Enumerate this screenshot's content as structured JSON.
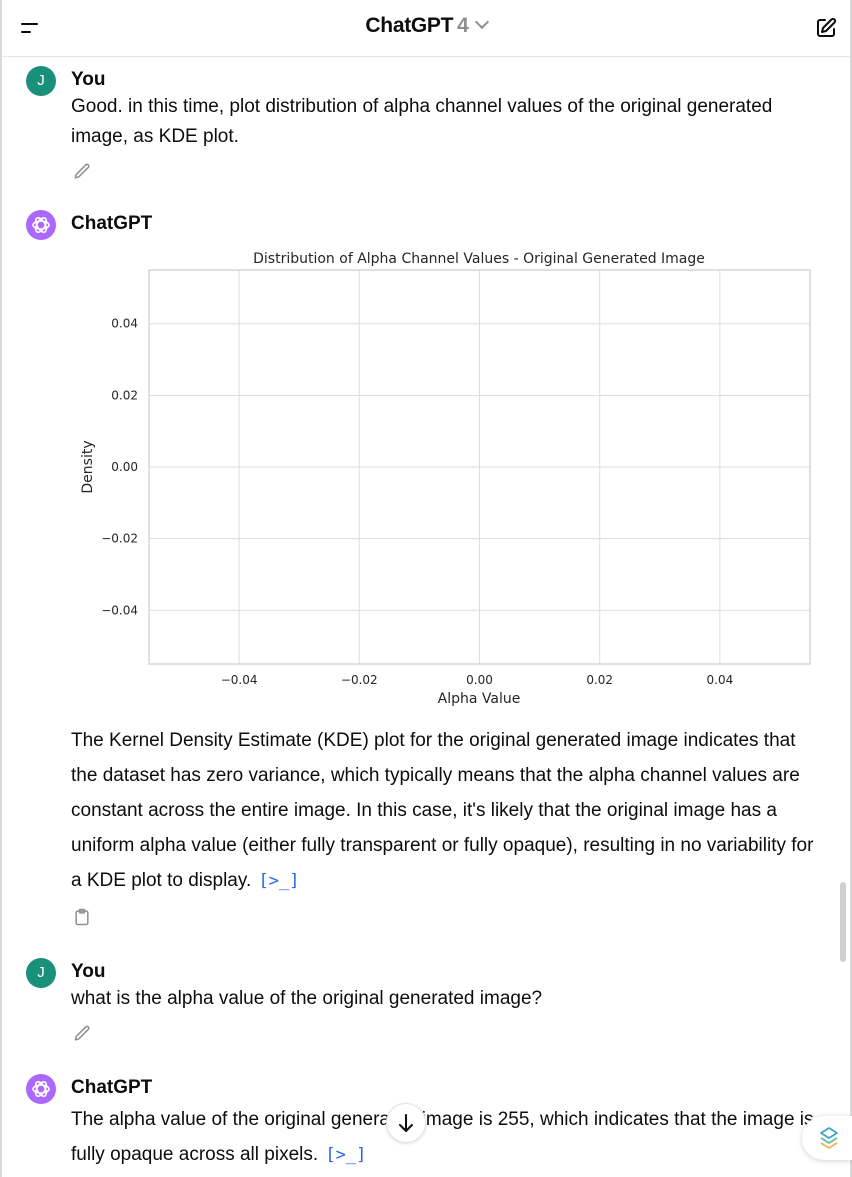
{
  "header": {
    "model_name": "ChatGPT",
    "model_version": "4"
  },
  "messages": [
    {
      "author": "You",
      "avatar_letter": "J",
      "text": "Good. in this time, plot distribution of alpha channel values of the original generated image, as KDE plot."
    },
    {
      "author": "ChatGPT",
      "text": "The Kernel Density Estimate (KDE) plot for the original generated image indicates that the dataset has zero variance, which typically means that the alpha channel values are constant across the entire image. In this case, it's likely that the original image has a uniform alpha value (either fully transparent or fully opaque), resulting in no variability for a KDE plot to display."
    },
    {
      "author": "You",
      "avatar_letter": "J",
      "text": "what is the alpha value of the original generated image?"
    },
    {
      "author": "ChatGPT",
      "text": "The alpha value of the original generated image is 255, which indicates that the image is fully opaque across all pixels."
    }
  ],
  "chart_data": {
    "type": "line",
    "title": "Distribution of Alpha Channel Values - Original Generated Image",
    "xlabel": "Alpha Value",
    "ylabel": "Density",
    "xlim": [
      -0.055,
      0.055
    ],
    "ylim": [
      -0.055,
      0.055
    ],
    "xticks": [
      -0.04,
      -0.02,
      0.0,
      0.02,
      0.04
    ],
    "yticks": [
      0.04,
      0.02,
      0.0,
      -0.02,
      -0.04
    ],
    "xtick_labels": [
      "−0.04",
      "−0.02",
      "0.00",
      "0.02",
      "0.04"
    ],
    "ytick_labels": [
      "0.04",
      "0.02",
      "0.00",
      "−0.02",
      "−0.04"
    ],
    "grid": true,
    "series": []
  },
  "colors": {
    "user_avatar": "#19907a",
    "bot_avatar": "#ab68ff",
    "code_link": "#2563eb",
    "grid": "#dddddd",
    "axes": "#cccccc"
  },
  "icons": {
    "menu": "menu-icon",
    "chevron": "chevron-down-icon",
    "new_chat": "new-chat-icon",
    "edit": "pencil-icon",
    "copy": "clipboard-icon",
    "openai": "openai-logo-icon",
    "code": "code-interpreter-icon",
    "scroll_down": "arrow-down-icon"
  }
}
